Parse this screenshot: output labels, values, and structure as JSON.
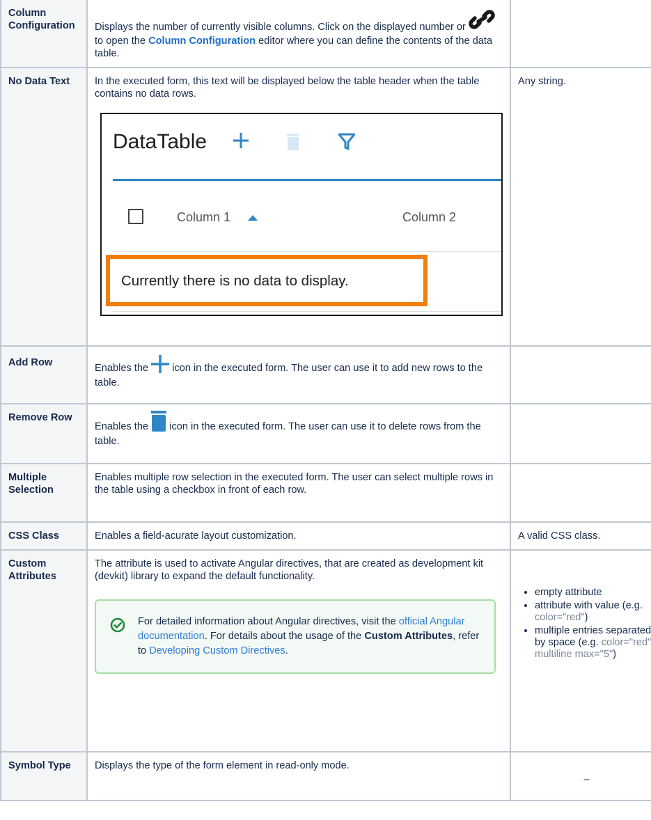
{
  "rows": {
    "column_configuration": {
      "label": "Column Configuration",
      "text_before": "Displays the number of currently visible columns. Click on the displayed number or ",
      "text_middle": " to open the ",
      "link": "Column Configuration",
      "text_after": " editor where you can define the contents of the data table.",
      "icon": "link-icon",
      "value": ""
    },
    "no_data_text": {
      "label": "No Data Text",
      "description": "In the executed form, this text will be displayed below the table header when the table contains no data rows.",
      "value": "Any string.",
      "example": {
        "title": "DataTable",
        "column1": "Column 1",
        "column2": "Column 2",
        "empty_message": "Currently there is no data to display.",
        "accent_color": "#2f86c6",
        "highlight_color": "#f07f0b"
      }
    },
    "add_row": {
      "label": "Add Row",
      "text_before": "Enables the ",
      "text_after": " icon in the executed form. The user can use it to add new rows to the table.",
      "icon": "plus-icon",
      "value": ""
    },
    "remove_row": {
      "label": "Remove Row",
      "text_before": "Enables the ",
      "text_after": " icon in the executed form. The user can use it to delete rows from the table.",
      "icon": "trash-icon",
      "value": ""
    },
    "multiple_selection": {
      "label": "Multiple Selection",
      "description": "Enables multiple row selection in the executed form. The user can select multiple rows in the table using a checkbox in front of each row.",
      "value": ""
    },
    "css_class": {
      "label": "CSS Class",
      "description": "Enables a field-acurate layout customization.",
      "value": "A valid CSS class."
    },
    "custom_attributes": {
      "label": "Custom Attributes",
      "description": "The attribute is used to activate Angular directives, that are created as development kit (devkit) library to expand the default functionality.",
      "info": {
        "text1": "For detailed information about Angular directives, visit the ",
        "link1": "official Angular documentation",
        "text2": ". For details about the usage of the ",
        "bold": "Custom Attributes",
        "text3": ", refer to ",
        "link2": "Developing Custom Directives",
        "text4": "."
      },
      "values": {
        "item1": "empty attribute",
        "item2_before": "attribute with value (e.g. ",
        "item2_code": "color=\"red\"",
        "item2_after": ")",
        "item3_before": "multiple entries separated by space (e.g. ",
        "item3_code": "color=\"red\" multiline max=\"5\"",
        "item3_after": ")"
      }
    },
    "symbol_type": {
      "label": "Symbol Type",
      "description": "Displays the type of the form element in read-only mode.",
      "value": "–"
    }
  }
}
